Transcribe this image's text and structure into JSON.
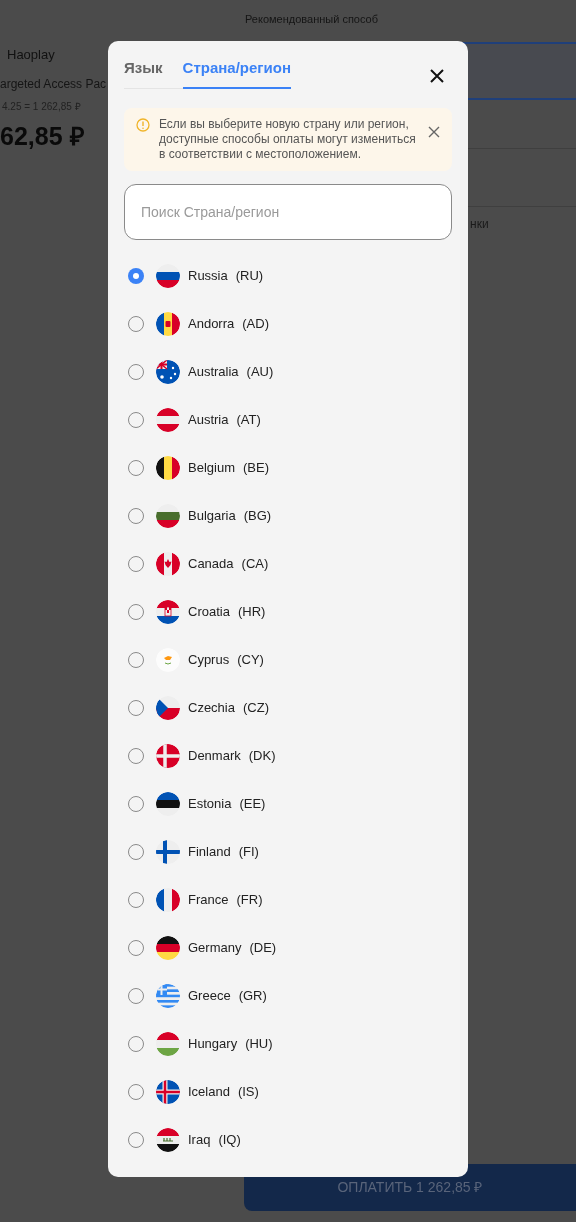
{
  "background": {
    "brand": "Haoplay",
    "product": "argeted Access Pac",
    "price_formula": "4.25 = 1 262,85 ₽",
    "price": "62,85 ₽",
    "recommended_label": "Рекомендованный способ",
    "partial_label": "нки",
    "pay_button": "ОПЛАТИТЬ 1 262,85 ₽"
  },
  "modal": {
    "tabs": [
      {
        "label": "Язык",
        "selected": false
      },
      {
        "label": "Страна/регион",
        "selected": true
      }
    ],
    "notice": {
      "text": "Если вы выберите новую страну или регион, доступные способы оплаты могут измениться в соответствии с местоположением."
    },
    "search": {
      "placeholder": "Поиск Страна/регион"
    },
    "countries": [
      {
        "name": "Russia",
        "code": "(RU)",
        "selected": true
      },
      {
        "name": "Andorra",
        "code": "(AD)",
        "selected": false
      },
      {
        "name": "Australia",
        "code": "(AU)",
        "selected": false
      },
      {
        "name": "Austria",
        "code": "(AT)",
        "selected": false
      },
      {
        "name": "Belgium",
        "code": "(BE)",
        "selected": false
      },
      {
        "name": "Bulgaria",
        "code": "(BG)",
        "selected": false
      },
      {
        "name": "Canada",
        "code": "(CA)",
        "selected": false
      },
      {
        "name": "Croatia",
        "code": "(HR)",
        "selected": false
      },
      {
        "name": "Cyprus",
        "code": "(CY)",
        "selected": false
      },
      {
        "name": "Czechia",
        "code": "(CZ)",
        "selected": false
      },
      {
        "name": "Denmark",
        "code": "(DK)",
        "selected": false
      },
      {
        "name": "Estonia",
        "code": "(EE)",
        "selected": false
      },
      {
        "name": "Finland",
        "code": "(FI)",
        "selected": false
      },
      {
        "name": "France",
        "code": "(FR)",
        "selected": false
      },
      {
        "name": "Germany",
        "code": "(DE)",
        "selected": false
      },
      {
        "name": "Greece",
        "code": "(GR)",
        "selected": false
      },
      {
        "name": "Hungary",
        "code": "(HU)",
        "selected": false
      },
      {
        "name": "Iceland",
        "code": "(IS)",
        "selected": false
      },
      {
        "name": "Iraq",
        "code": "(IQ)",
        "selected": false
      }
    ]
  }
}
